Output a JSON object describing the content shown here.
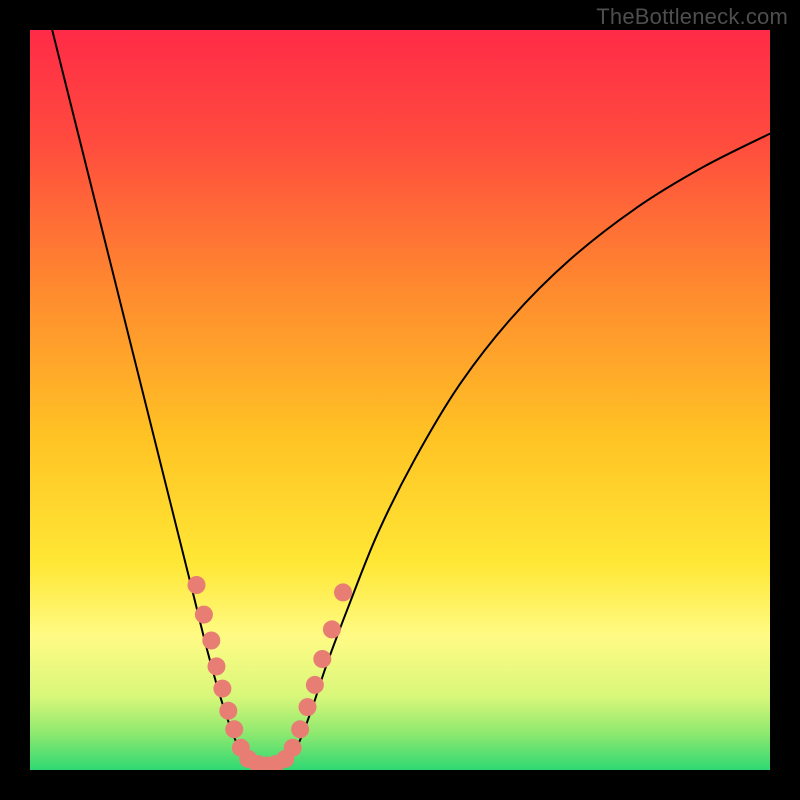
{
  "watermark": "TheBottleneck.com",
  "chart_data": {
    "type": "line",
    "title": "",
    "xlabel": "",
    "ylabel": "",
    "xlim": [
      0,
      100
    ],
    "ylim": [
      0,
      100
    ],
    "background_gradient": {
      "stops": [
        {
          "offset": 0.0,
          "color": "#ff2b47"
        },
        {
          "offset": 0.15,
          "color": "#ff4b3e"
        },
        {
          "offset": 0.35,
          "color": "#ff8a2f"
        },
        {
          "offset": 0.55,
          "color": "#ffc324"
        },
        {
          "offset": 0.72,
          "color": "#ffe735"
        },
        {
          "offset": 0.82,
          "color": "#fffb85"
        },
        {
          "offset": 0.9,
          "color": "#d9f77a"
        },
        {
          "offset": 0.95,
          "color": "#8fe96f"
        },
        {
          "offset": 1.0,
          "color": "#2fd873"
        }
      ]
    },
    "series": [
      {
        "name": "bottleneck-curve",
        "color": "#000000",
        "width": 2,
        "points": [
          {
            "x": 3.0,
            "y": 100.0
          },
          {
            "x": 5.0,
            "y": 92.0
          },
          {
            "x": 8.0,
            "y": 80.0
          },
          {
            "x": 11.0,
            "y": 68.0
          },
          {
            "x": 14.0,
            "y": 56.0
          },
          {
            "x": 17.0,
            "y": 44.0
          },
          {
            "x": 20.0,
            "y": 32.0
          },
          {
            "x": 22.0,
            "y": 24.0
          },
          {
            "x": 24.0,
            "y": 16.0
          },
          {
            "x": 26.0,
            "y": 9.0
          },
          {
            "x": 28.0,
            "y": 3.5
          },
          {
            "x": 30.0,
            "y": 0.8
          },
          {
            "x": 32.0,
            "y": 0.5
          },
          {
            "x": 34.0,
            "y": 0.8
          },
          {
            "x": 36.0,
            "y": 3.0
          },
          {
            "x": 38.0,
            "y": 8.0
          },
          {
            "x": 40.0,
            "y": 14.0
          },
          {
            "x": 43.0,
            "y": 22.0
          },
          {
            "x": 47.0,
            "y": 32.0
          },
          {
            "x": 52.0,
            "y": 42.0
          },
          {
            "x": 58.0,
            "y": 52.0
          },
          {
            "x": 65.0,
            "y": 61.0
          },
          {
            "x": 73.0,
            "y": 69.0
          },
          {
            "x": 82.0,
            "y": 76.0
          },
          {
            "x": 91.0,
            "y": 81.5
          },
          {
            "x": 100.0,
            "y": 86.0
          }
        ]
      }
    ],
    "scatter": {
      "name": "sample-points",
      "color": "#e87d74",
      "radius": 9,
      "points": [
        {
          "x": 22.5,
          "y": 25.0
        },
        {
          "x": 23.5,
          "y": 21.0
        },
        {
          "x": 24.5,
          "y": 17.5
        },
        {
          "x": 25.2,
          "y": 14.0
        },
        {
          "x": 26.0,
          "y": 11.0
        },
        {
          "x": 26.8,
          "y": 8.0
        },
        {
          "x": 27.6,
          "y": 5.5
        },
        {
          "x": 28.5,
          "y": 3.0
        },
        {
          "x": 29.5,
          "y": 1.5
        },
        {
          "x": 30.8,
          "y": 0.8
        },
        {
          "x": 32.0,
          "y": 0.6
        },
        {
          "x": 33.2,
          "y": 0.8
        },
        {
          "x": 34.5,
          "y": 1.5
        },
        {
          "x": 35.5,
          "y": 3.0
        },
        {
          "x": 36.5,
          "y": 5.5
        },
        {
          "x": 37.5,
          "y": 8.5
        },
        {
          "x": 38.5,
          "y": 11.5
        },
        {
          "x": 39.5,
          "y": 15.0
        },
        {
          "x": 40.8,
          "y": 19.0
        },
        {
          "x": 42.3,
          "y": 24.0
        }
      ]
    }
  }
}
